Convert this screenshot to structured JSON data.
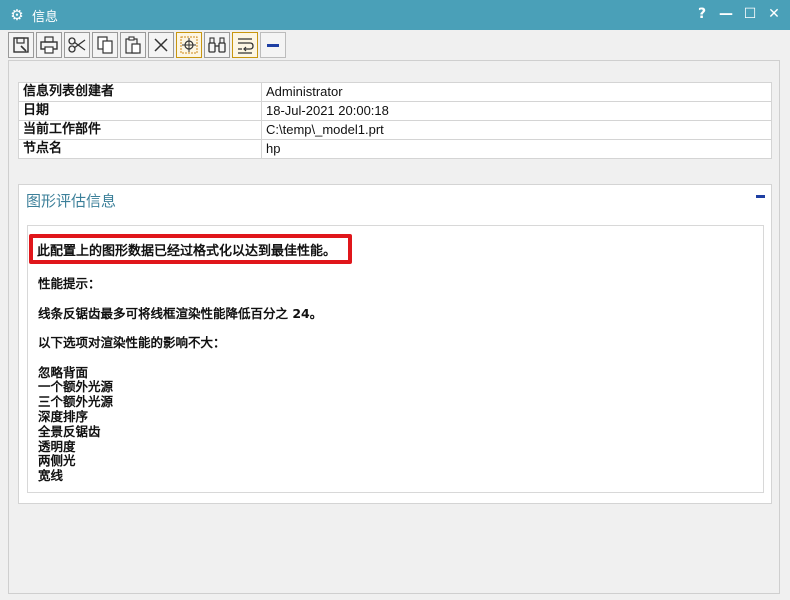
{
  "window": {
    "title": "信息",
    "help_label": "?",
    "minimize_label": "—",
    "maximize_label": "☐",
    "close_label": "✕"
  },
  "info_table": [
    {
      "key": "信息列表创建者",
      "value": "Administrator"
    },
    {
      "key": "日期",
      "value": "18-Jul-2021 20:00:18"
    },
    {
      "key": "当前工作部件",
      "value": "C:\\temp\\_model1.prt"
    },
    {
      "key": "节点名",
      "value": "hp"
    }
  ],
  "section": {
    "title": "图形评估信息",
    "highlight": "此配置上的图形数据已经过格式化以达到最佳性能。",
    "perf_tip_label": "性能提示：",
    "perf_tip": "线条反锯齿最多可将线框渲染性能降低百分之 24。",
    "minor_impact_label": "以下选项对渲染性能的影响不大：",
    "options": [
      "忽略背面",
      "一个额外光源",
      "三个额外光源",
      "深度排序",
      "全景反锯齿",
      "透明度",
      "两侧光",
      "宽线"
    ]
  },
  "colors": {
    "titlebar": "#4aa0b8",
    "highlight_border": "#e0161b",
    "section_title": "#3b7f99",
    "accent_blue": "#1e3fa3"
  },
  "icons": {
    "toolbar": [
      "save-icon",
      "print-icon",
      "cut-icon",
      "copy-icon",
      "paste-icon",
      "delete-icon",
      "target-icon",
      "binoculars-icon",
      "wrap-text-icon",
      "minus-icon"
    ]
  }
}
